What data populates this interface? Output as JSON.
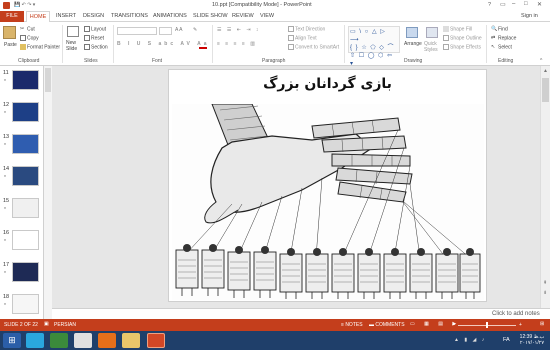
{
  "window": {
    "title": "10.ppt [Compatibility Mode] - PowerPoint",
    "help_icon": "?",
    "sign_in": "Sign in"
  },
  "ribbon_tabs": [
    "FILE",
    "HOME",
    "INSERT",
    "DESIGN",
    "TRANSITIONS",
    "ANIMATIONS",
    "SLIDE SHOW",
    "REVIEW",
    "VIEW"
  ],
  "clipboard": {
    "paste": "Paste",
    "cut": "Cut",
    "copy": "Copy",
    "format_painter": "Format Painter",
    "label": "Clipboard"
  },
  "slides_group": {
    "new_slide": "New Slide",
    "layout": "Layout",
    "reset": "Reset",
    "section": "Section",
    "label": "Slides"
  },
  "font_group": {
    "label": "Font"
  },
  "paragraph_group": {
    "text_direction": "Text Direction",
    "align_text": "Align Text",
    "convert_smartart": "Convert to SmartArt",
    "label": "Paragraph"
  },
  "drawing_group": {
    "arrange": "Arrange",
    "quick_styles": "Quick Styles",
    "shape_fill": "Shape Fill",
    "shape_outline": "Shape Outline",
    "shape_effects": "Shape Effects",
    "label": "Drawing"
  },
  "editing_group": {
    "find": "Find",
    "replace": "Replace",
    "select": "Select",
    "label": "Editing"
  },
  "thumbnails": [
    {
      "num": "11",
      "star": "*"
    },
    {
      "num": "12",
      "star": "*"
    },
    {
      "num": "13",
      "star": "*"
    },
    {
      "num": "14",
      "star": "*"
    },
    {
      "num": "15",
      "star": "*"
    },
    {
      "num": "16",
      "star": "*"
    },
    {
      "num": "17",
      "star": "*"
    },
    {
      "num": "18",
      "star": "*"
    }
  ],
  "slide": {
    "title": "بازی گردانان بزرگ"
  },
  "notes_placeholder": "Click to add notes",
  "status": {
    "slide_of": "SLIDE 2 OF 22",
    "language": "PERSIAN",
    "notes": "NOTES",
    "comments": "COMMENTS"
  },
  "taskbar": {
    "lang": "FA",
    "time": "12:39 ب.ظ",
    "date": "۲۰۱۷/۰۱/۲۷"
  }
}
